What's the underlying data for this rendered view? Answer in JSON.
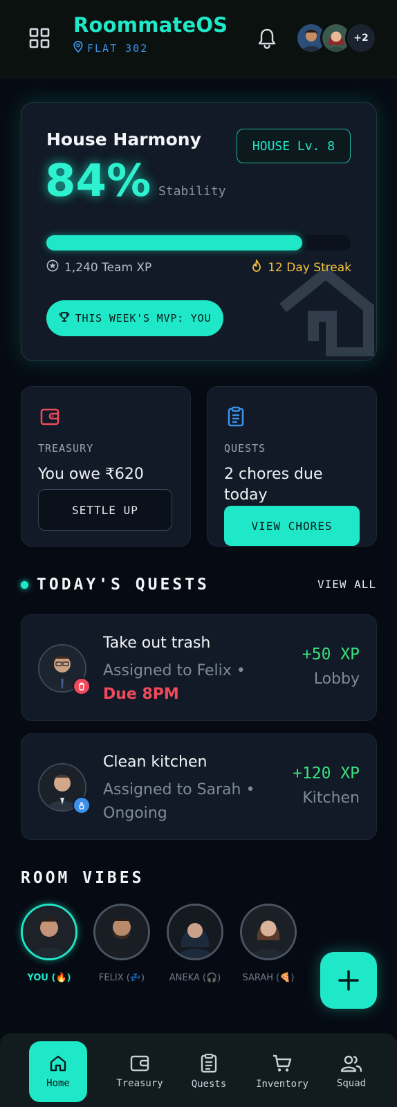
{
  "header": {
    "title": "RoommateOS",
    "flat": "FLAT 302",
    "more_count": "+2"
  },
  "harmony": {
    "title": "House Harmony",
    "level": "HOUSE Lv. 8",
    "percent": "84%",
    "percent_value": 0.84,
    "stability_label": "Stability",
    "team_xp": "1,240 Team XP",
    "streak": "12 Day Streak",
    "mvp": "THIS WEEK'S MVP: YOU"
  },
  "treasury": {
    "label": "TREASURY",
    "value": "You owe ₹620",
    "button": "SETTLE UP"
  },
  "quests_card": {
    "label": "QUESTS",
    "value": "2 chores due today",
    "button": "VIEW CHORES"
  },
  "todays_quests": {
    "title": "TODAY'S QUESTS",
    "view_all": "VIEW ALL",
    "items": [
      {
        "title": "Take out trash",
        "assigned": "Assigned to Felix •",
        "status": "Due 8PM",
        "xp": "+50 XP",
        "room": "Lobby"
      },
      {
        "title": "Clean kitchen",
        "assigned": "Assigned to Sarah •",
        "status": "Ongoing",
        "xp": "+120 XP",
        "room": "Kitchen"
      }
    ]
  },
  "room_vibes": {
    "title": "ROOM VIBES",
    "people": [
      {
        "label": "YOU (🔥)"
      },
      {
        "label": "FELIX (💤)"
      },
      {
        "label": "ANEKA (🎧)"
      },
      {
        "label": "SARAH (🍕)"
      }
    ]
  },
  "nav": {
    "items": [
      {
        "label": "Home"
      },
      {
        "label": "Treasury"
      },
      {
        "label": "Quests"
      },
      {
        "label": "Inventory"
      },
      {
        "label": "Squad"
      }
    ]
  },
  "colors": {
    "accent": "#1fe8c8",
    "background": "#060b13",
    "card": "#111a26",
    "danger": "#ef4a5c",
    "xp_green": "#3be27f",
    "streak_gold": "#f7c23d",
    "link_blue": "#3d8fe8"
  }
}
